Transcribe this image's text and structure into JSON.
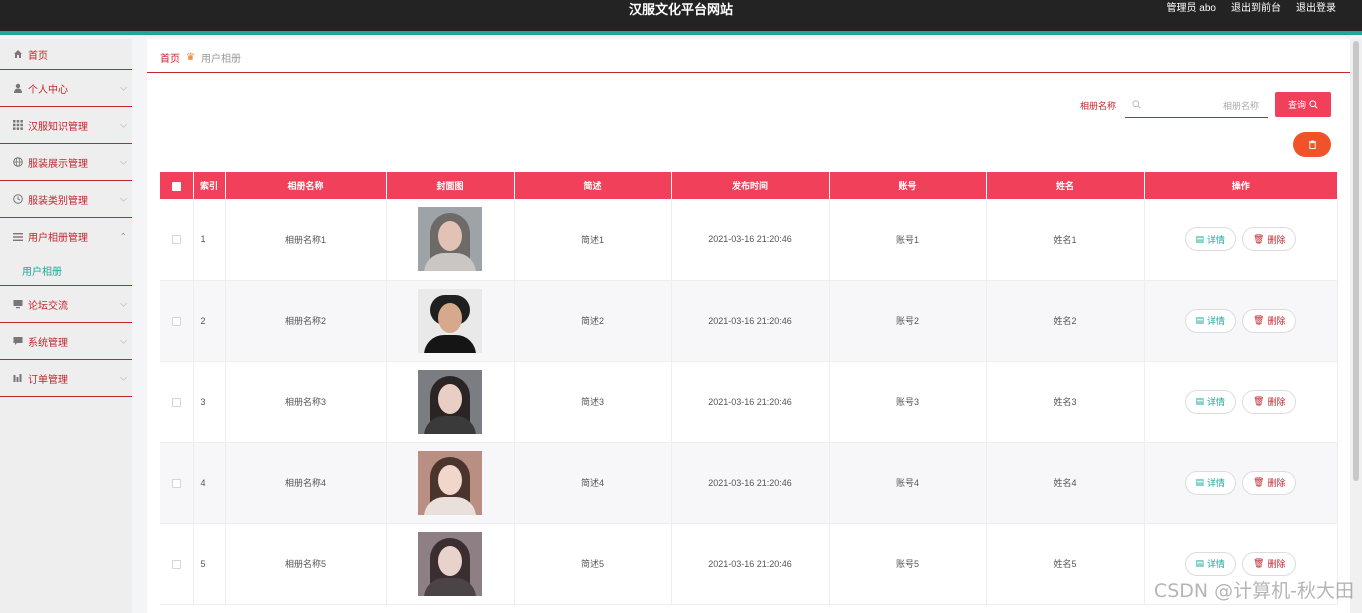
{
  "header": {
    "title": "汉服文化平台网站",
    "admin": "管理员 abo",
    "to_front": "退出到前台",
    "logout": "退出登录"
  },
  "sidebar": {
    "items": [
      {
        "label": "首页",
        "icon": "home-icon"
      },
      {
        "label": "个人中心",
        "icon": "user-icon"
      },
      {
        "label": "汉服知识管理",
        "icon": "grid-icon"
      },
      {
        "label": "服装展示管理",
        "icon": "globe-icon"
      },
      {
        "label": "服装类别管理",
        "icon": "clock-icon"
      },
      {
        "label": "用户相册管理",
        "icon": "list-icon",
        "expanded": true,
        "sub": "用户相册"
      },
      {
        "label": "论坛交流",
        "icon": "monitor-icon"
      },
      {
        "label": "系统管理",
        "icon": "chat-icon"
      },
      {
        "label": "订单管理",
        "icon": "chart-icon"
      }
    ]
  },
  "breadcrumb": {
    "home": "首页",
    "current": "用户相册"
  },
  "search": {
    "label": "相册名称",
    "placeholder": "相册名称",
    "button": "查询"
  },
  "table": {
    "columns": [
      "索引",
      "相册名称",
      "封面图",
      "简述",
      "发布时间",
      "账号",
      "姓名",
      "操作"
    ],
    "detail_label": "详情",
    "delete_label": "删除",
    "rows": [
      {
        "index": "1",
        "name": "相册名称1",
        "desc": "简述1",
        "time": "2021-03-16 21:20:46",
        "account": "账号1",
        "realname": "姓名1"
      },
      {
        "index": "2",
        "name": "相册名称2",
        "desc": "简述2",
        "time": "2021-03-16 21:20:46",
        "account": "账号2",
        "realname": "姓名2"
      },
      {
        "index": "3",
        "name": "相册名称3",
        "desc": "简述3",
        "time": "2021-03-16 21:20:46",
        "account": "账号3",
        "realname": "姓名3"
      },
      {
        "index": "4",
        "name": "相册名称4",
        "desc": "简述4",
        "time": "2021-03-16 21:20:46",
        "account": "账号4",
        "realname": "姓名4"
      },
      {
        "index": "5",
        "name": "相册名称5",
        "desc": "简述5",
        "time": "2021-03-16 21:20:46",
        "account": "账号5",
        "realname": "姓名5"
      }
    ]
  },
  "watermark": "CSDN @计算机-秋大田",
  "colors": {
    "accent": "#f0405a",
    "brand": "#c1272d",
    "teal": "#1ea79a",
    "orange": "#f0532a"
  }
}
